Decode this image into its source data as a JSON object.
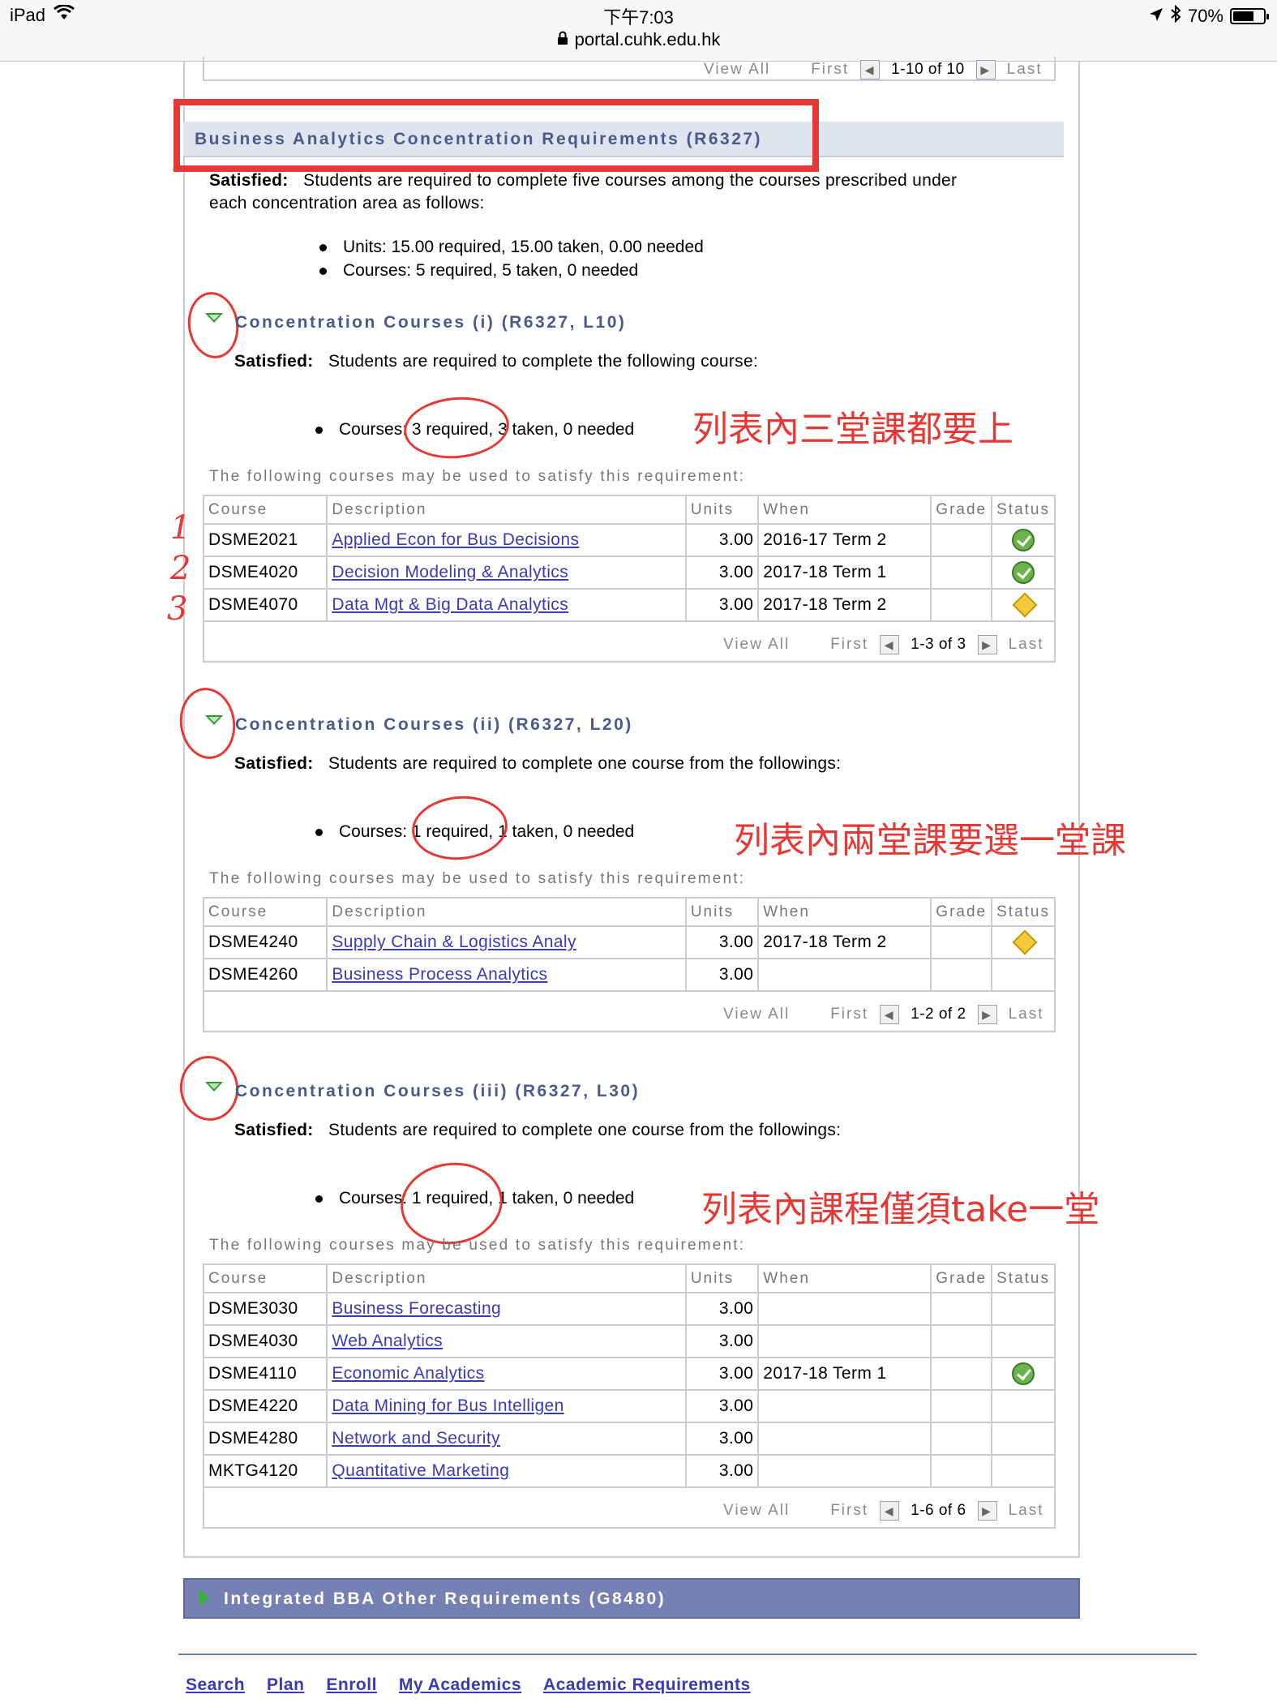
{
  "status_bar": {
    "device": "iPad",
    "time": "下午7:03",
    "url": "portal.cuhk.edu.hk",
    "battery": "70%",
    "battery_level": 0.7
  },
  "top_pager": {
    "view_all": "View All",
    "first": "First",
    "count": "1-10 of 10",
    "last": "Last"
  },
  "section": {
    "title": "Business Analytics Concentration Requirements (R6327)",
    "satisfied_label": "Satisfied:",
    "description_line1": "Students are required to complete five courses among the courses prescribed under",
    "description_line2": "each concentration area as follows:",
    "bullets": [
      "Units: 15.00 required, 15.00 taken, 0.00 needed",
      "Courses: 5 required, 5 taken, 0 needed"
    ]
  },
  "table_headers": {
    "course": "Course",
    "description": "Description",
    "units": "Units",
    "when": "When",
    "grade": "Grade",
    "status": "Status"
  },
  "following_text": "The following courses may be used to satisfy this requirement:",
  "groups": [
    {
      "title": "Concentration Courses (i) (R6327, L10)",
      "satisfied_label": "Satisfied:",
      "description": "Students are required to complete the following course:",
      "bullet": "Courses: 3 required, 3 taken, 0 needed",
      "annotation": "列表內三堂課都要上",
      "rows": [
        {
          "course": "DSME2021",
          "description": "Applied Econ for Bus Decisions",
          "units": "3.00",
          "when": "2016-17 Term 2",
          "grade": "",
          "status": "taken"
        },
        {
          "course": "DSME4020",
          "description": "Decision Modeling & Analytics",
          "units": "3.00",
          "when": "2017-18 Term 1",
          "grade": "",
          "status": "taken"
        },
        {
          "course": "DSME4070",
          "description": "Data Mgt & Big Data Analytics",
          "units": "3.00",
          "when": "2017-18 Term 2",
          "grade": "",
          "status": "in-progress"
        }
      ],
      "pager": {
        "view_all": "View All",
        "first": "First",
        "count": "1-3 of 3",
        "last": "Last"
      }
    },
    {
      "title": "Concentration Courses (ii) (R6327, L20)",
      "satisfied_label": "Satisfied:",
      "description": "Students are required to complete one course from the followings:",
      "bullet": "Courses: 1 required, 1 taken, 0 needed",
      "annotation": "列表內兩堂課要選一堂課",
      "rows": [
        {
          "course": "DSME4240",
          "description": "Supply Chain & Logistics Analy",
          "units": "3.00",
          "when": "2017-18 Term 2",
          "grade": "",
          "status": "in-progress"
        },
        {
          "course": "DSME4260",
          "description": "Business Process Analytics",
          "units": "3.00",
          "when": "",
          "grade": "",
          "status": ""
        }
      ],
      "pager": {
        "view_all": "View All",
        "first": "First",
        "count": "1-2 of 2",
        "last": "Last"
      }
    },
    {
      "title": "Concentration Courses (iii) (R6327, L30)",
      "satisfied_label": "Satisfied:",
      "description": "Students are required to complete one course from the followings:",
      "bullet": "Courses: 1 required, 1 taken, 0 needed",
      "annotation": "列表內課程僅須take一堂",
      "rows": [
        {
          "course": "DSME3030",
          "description": "Business Forecasting",
          "units": "3.00",
          "when": "",
          "grade": "",
          "status": ""
        },
        {
          "course": "DSME4030",
          "description": "Web Analytics",
          "units": "3.00",
          "when": "",
          "grade": "",
          "status": ""
        },
        {
          "course": "DSME4110",
          "description": "Economic Analytics",
          "units": "3.00",
          "when": "2017-18 Term 1",
          "grade": "",
          "status": "taken"
        },
        {
          "course": "DSME4220",
          "description": "Data Mining for Bus Intelligen",
          "units": "3.00",
          "when": "",
          "grade": "",
          "status": ""
        },
        {
          "course": "DSME4280",
          "description": "Network and Security",
          "units": "3.00",
          "when": "",
          "grade": "",
          "status": ""
        },
        {
          "course": "MKTG4120",
          "description": "Quantitative Marketing",
          "units": "3.00",
          "when": "",
          "grade": "",
          "status": ""
        }
      ],
      "pager": {
        "view_all": "View All",
        "first": "First",
        "count": "1-6 of 6",
        "last": "Last"
      }
    }
  ],
  "hand_numbers": [
    "1",
    "2",
    "3"
  ],
  "other_requirements": {
    "title": "Integrated BBA Other Requirements (G8480)"
  },
  "footer_links": [
    "Search",
    "Plan",
    "Enroll",
    "My Academics",
    "Academic Requirements"
  ]
}
